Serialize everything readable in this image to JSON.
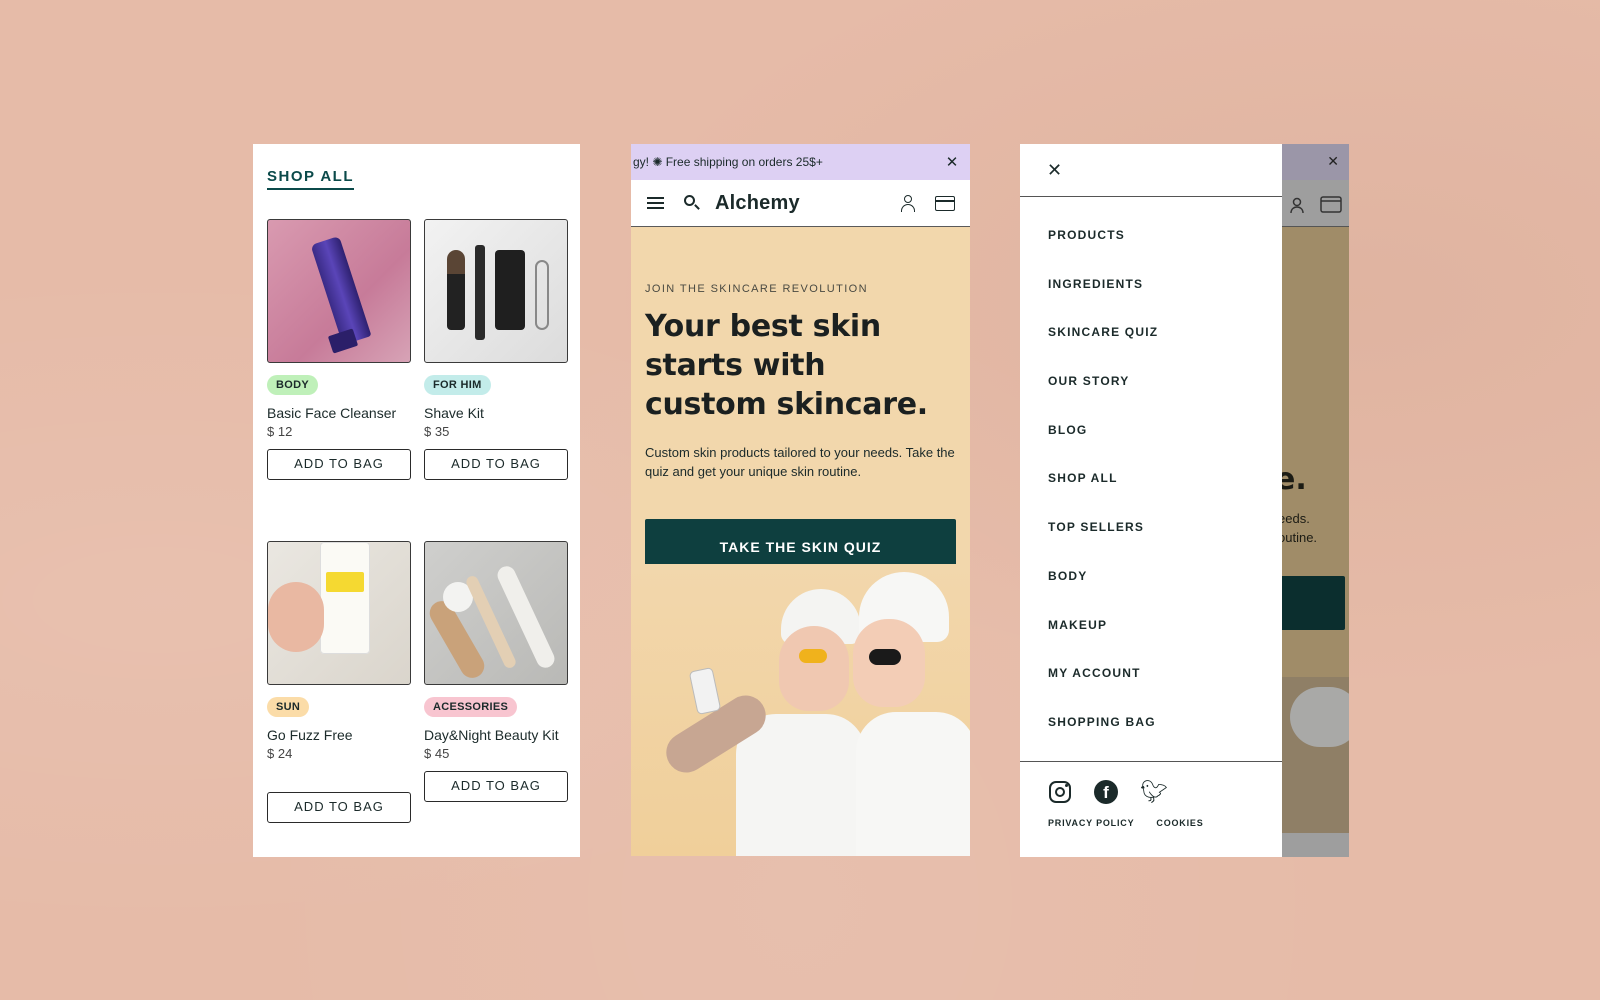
{
  "shop": {
    "title": "SHOP ALL",
    "products": [
      {
        "badge": "BODY",
        "badge_color": "#bff0b9",
        "name": "Basic Face Cleanser",
        "price": "$ 12",
        "button": "ADD TO BAG"
      },
      {
        "badge": "FOR HIM",
        "badge_color": "#c3ecea",
        "name": "Shave Kit",
        "price": "$ 35",
        "button": "ADD TO BAG"
      },
      {
        "badge": "SUN",
        "badge_color": "#fbdca8",
        "name": "Go Fuzz Free",
        "price": "$ 24",
        "button": "ADD TO BAG"
      },
      {
        "badge": "ACESSORIES",
        "badge_color": "#f8c5d0",
        "name": "Day&Night Beauty Kit",
        "price": "$ 45",
        "button": "ADD TO BAG"
      }
    ]
  },
  "home": {
    "promo": "gy! ✺ Free shipping on orders 25$+",
    "close": "✕",
    "logo": "Alchemy",
    "eyebrow": "JOIN THE SKINCARE REVOLUTION",
    "headline": "Your best skin starts with custom skincare.",
    "subcopy": "Custom skin products tailored to your needs. Take the quiz and get your unique skin routine.",
    "cta": "TAKE THE SKIN QUIZ"
  },
  "menu": {
    "close": "✕",
    "items": [
      "PRODUCTS",
      "INGREDIENTS",
      "SKINCARE QUIZ",
      "OUR STORY",
      "BLOG",
      "SHOP ALL",
      "TOP SELLERS",
      "BODY",
      "MAKEUP",
      "MY ACCOUNT",
      "SHOPPING BAG"
    ],
    "social_icons": [
      "instagram-icon",
      "facebook-icon",
      "twitter-icon"
    ],
    "legal": [
      "PRIVACY POLICY",
      "COOKIES"
    ],
    "behind": {
      "close": "✕",
      "headline_fragment": "are.",
      "copy_line1": "eeds.",
      "copy_line2": "outine."
    }
  },
  "colors": {
    "background": "#e6bba8",
    "accent_dark_teal": "#0e3f3f",
    "promo_lavender": "#ddd0f3",
    "hero_sand": "#f2d7ac"
  }
}
